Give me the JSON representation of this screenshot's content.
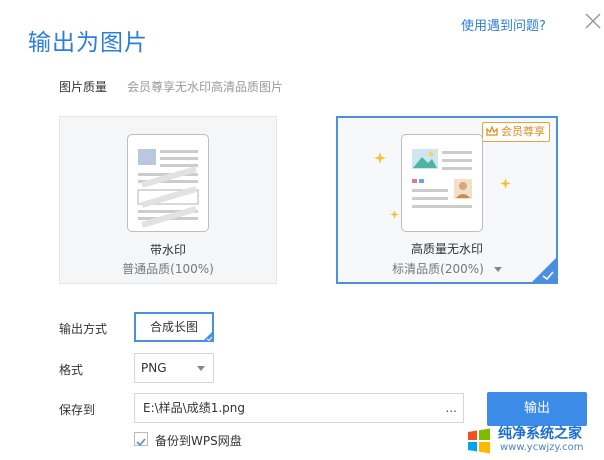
{
  "dialog": {
    "title": "输出为图片",
    "help_link": "使用遇到问题?",
    "close_icon": "close-icon"
  },
  "quality": {
    "label": "图片质量",
    "hint": "会员尊享无水印高清品质图片",
    "options": [
      {
        "name": "带水印",
        "subtitle": "普通品质(100%)",
        "selected": false
      },
      {
        "name": "高质量无水印",
        "subtitle": "标清品质(200%)",
        "badge": "会员尊享",
        "selected": true
      }
    ]
  },
  "output_mode": {
    "label": "输出方式",
    "value": "合成长图"
  },
  "format": {
    "label": "格式",
    "value": "PNG"
  },
  "save_to": {
    "label": "保存到",
    "path": "E:\\样品\\成绩1.png",
    "browse": "..."
  },
  "export_button": "输出",
  "backup": {
    "label": "备份到WPS网盘",
    "checked": true
  },
  "watermark": {
    "title": "纯净系统之家",
    "url": "www.ycwjzy.com"
  },
  "colors": {
    "accent": "#3c8be6",
    "vip": "#e08a1a"
  }
}
